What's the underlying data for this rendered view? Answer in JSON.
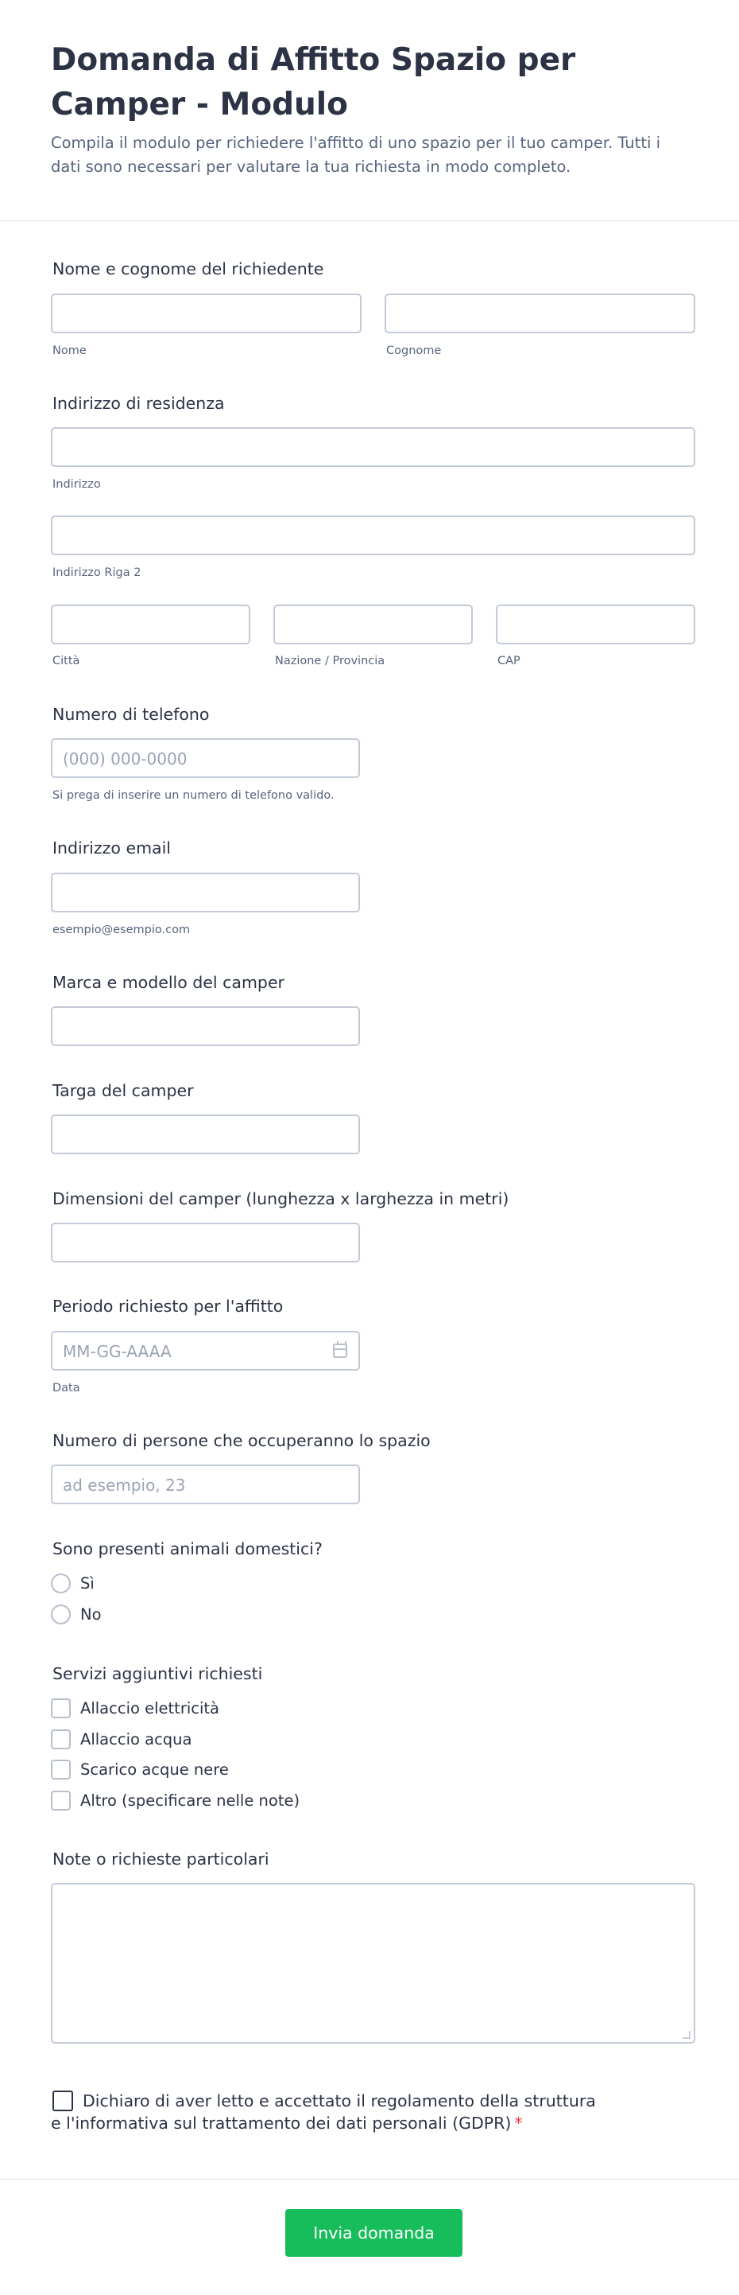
{
  "header": {
    "title": "Domanda di Affitto Spazio per Camper - Modulo",
    "subtitle": "Compila il modulo per richiedere l'affitto di uno spazio per il tuo camper. Tutti i dati sono necessari per valutare la tua richiesta in modo completo."
  },
  "fields": {
    "name": {
      "label": "Nome e cognome del richiedente",
      "first_sublabel": "Nome",
      "last_sublabel": "Cognome"
    },
    "address": {
      "label": "Indirizzo di residenza",
      "line1_sublabel": "Indirizzo",
      "line2_sublabel": "Indirizzo Riga 2",
      "city_sublabel": "Città",
      "state_sublabel": "Nazione / Provincia",
      "zip_sublabel": "CAP"
    },
    "phone": {
      "label": "Numero di telefono",
      "placeholder": "(000) 000-0000",
      "sublabel": "Si prega di inserire un numero di telefono valido."
    },
    "email": {
      "label": "Indirizzo email",
      "sublabel": "esempio@esempio.com"
    },
    "camper_model": {
      "label": "Marca e modello del camper"
    },
    "plate": {
      "label": "Targa del camper"
    },
    "dimensions": {
      "label": "Dimensioni del camper (lunghezza x larghezza in metri)"
    },
    "period": {
      "label": "Periodo richiesto per l'affitto",
      "placeholder": "MM-GG-AAAA",
      "sublabel": "Data",
      "icon": "calendar-icon"
    },
    "people": {
      "label": "Numero di persone che occuperanno lo spazio",
      "placeholder": "ad esempio, 23"
    },
    "pets": {
      "label": "Sono presenti animali domestici?",
      "options": [
        "Sì",
        "No"
      ]
    },
    "services": {
      "label": "Servizi aggiuntivi richiesti",
      "options": [
        "Allaccio elettricità",
        "Allaccio acqua",
        "Scarico acque nere",
        "Altro (specificare nelle note)"
      ]
    },
    "notes": {
      "label": "Note o richieste particolari"
    },
    "consent": {
      "text": "Dichiaro di aver letto e accettato il regolamento della struttura e l'informativa sul trattamento dei dati personali (GDPR)",
      "required_mark": "*"
    }
  },
  "submit": {
    "label": "Invia domanda"
  },
  "colors": {
    "accent": "#18bd5b",
    "required": "#f23a3c",
    "text": "#2c3345",
    "muted": "#57647e",
    "border": "#c3cad8"
  }
}
